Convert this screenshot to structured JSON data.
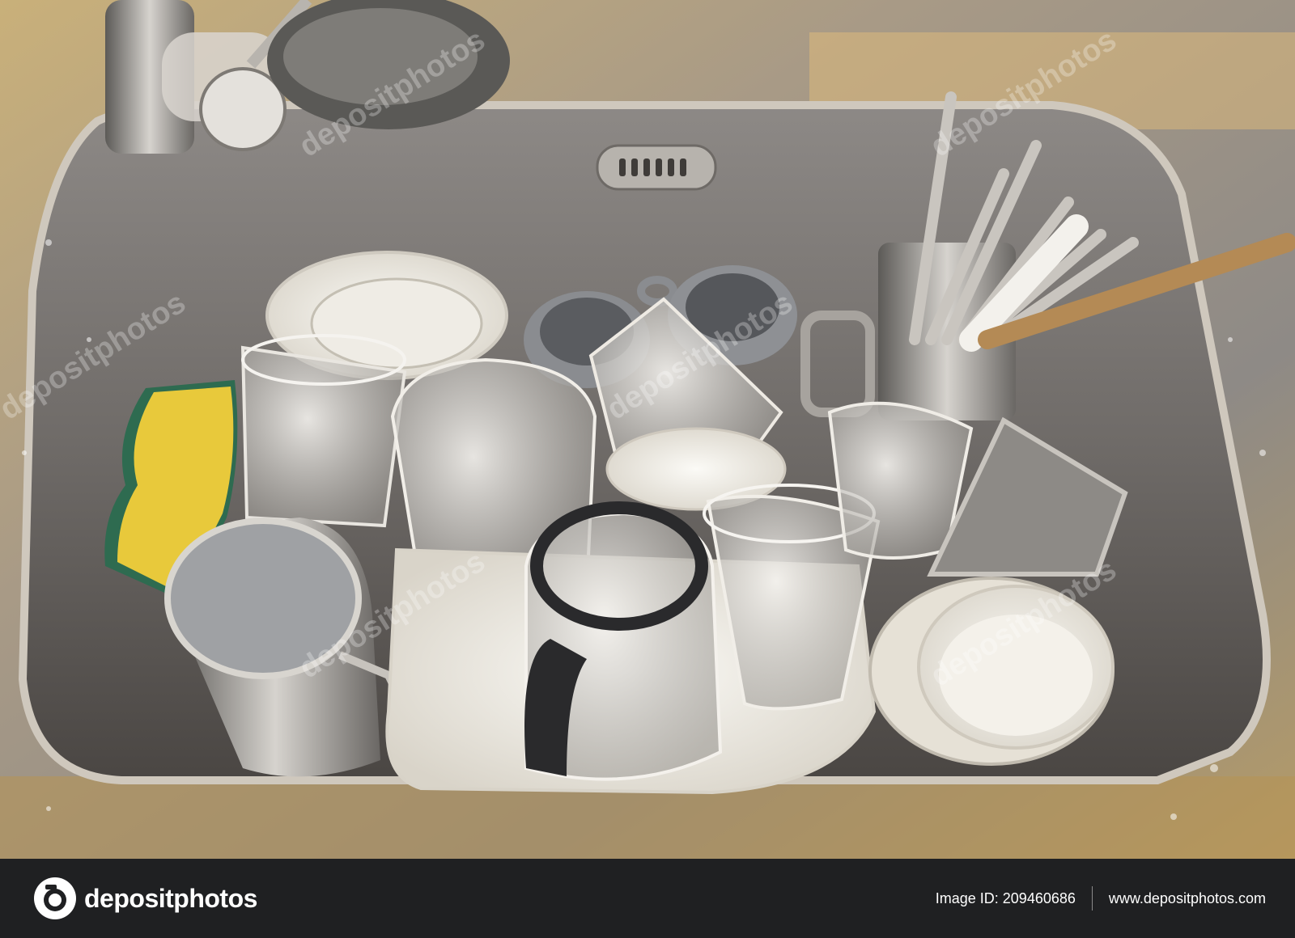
{
  "photo": {
    "watermark": "depositphotos"
  },
  "footer": {
    "brand": "depositphotos",
    "image_id_label": "Image ID: 209460686",
    "site_url": "www.depositphotos.com"
  }
}
